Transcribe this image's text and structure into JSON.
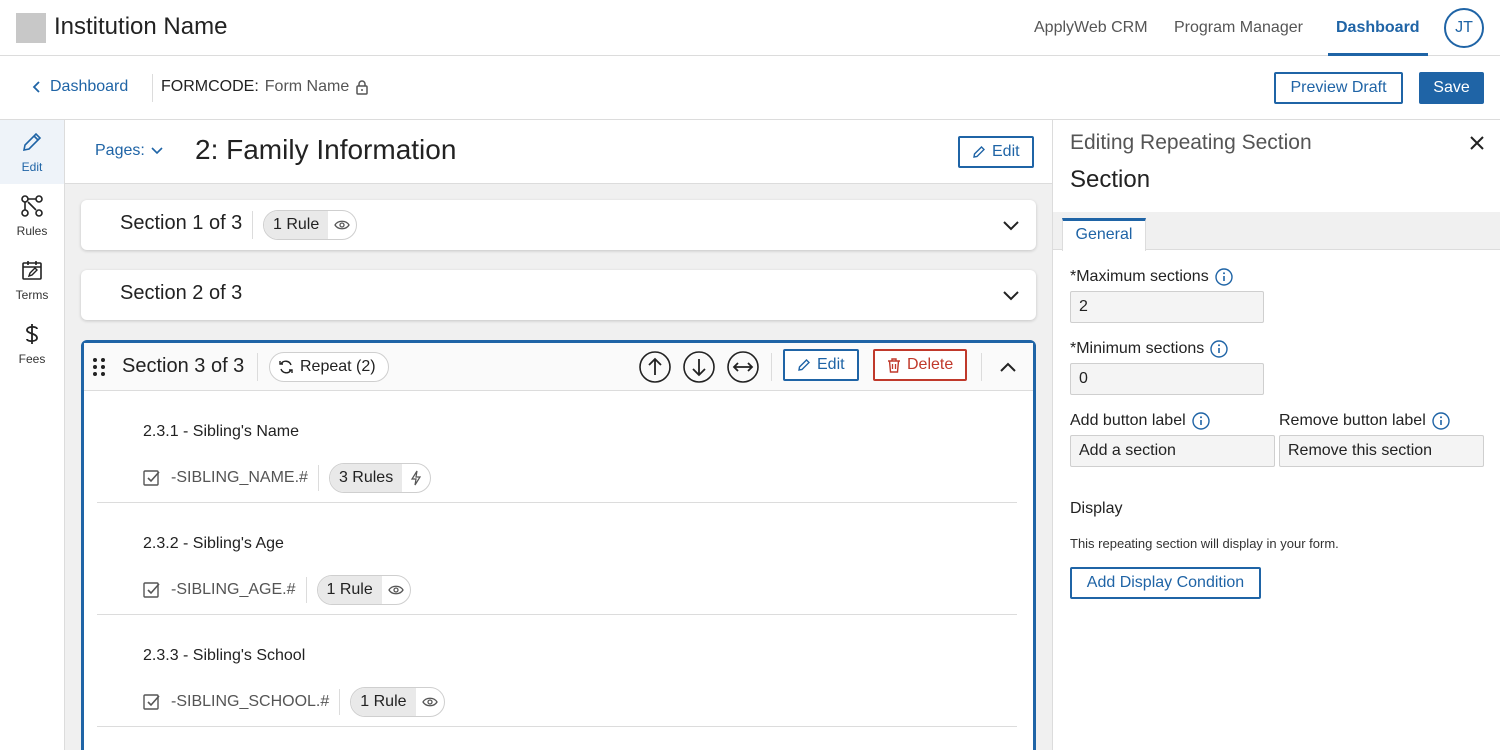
{
  "header": {
    "institution_name": "Institution Name",
    "nav": [
      "ApplyWeb CRM",
      "Program Manager",
      "Dashboard"
    ],
    "active_nav": "Dashboard",
    "avatar_initials": "JT"
  },
  "subheader": {
    "back_label": "Dashboard",
    "formcode_label": "FORMCODE:",
    "form_name": "Form Name",
    "preview_label": "Preview Draft",
    "save_label": "Save"
  },
  "rail": [
    {
      "label": "Edit",
      "icon": "pencil-icon"
    },
    {
      "label": "Rules",
      "icon": "rules-icon"
    },
    {
      "label": "Terms",
      "icon": "calendar-edit-icon"
    },
    {
      "label": "Fees",
      "icon": "dollar-icon"
    }
  ],
  "main": {
    "pages_label": "Pages:",
    "page_title": "2: Family Information",
    "edit_label": "Edit",
    "sections": [
      {
        "title": "Section 1 of 3",
        "chip": "1 Rule"
      },
      {
        "title": "Section 2 of 3"
      }
    ],
    "open_section": {
      "title": "Section 3 of 3",
      "repeat_label": "Repeat (2)",
      "edit_label": "Edit",
      "delete_label": "Delete",
      "fields": [
        {
          "title": "2.3.1 - Sibling's Name",
          "code": "-SIBLING_NAME.#",
          "chip": "3 Rules",
          "chip_icon": "lightning-icon"
        },
        {
          "title": "2.3.2 - Sibling's Age",
          "code": "-SIBLING_AGE.#",
          "chip": "1 Rule",
          "chip_icon": "eye-icon"
        },
        {
          "title": "2.3.3 - Sibling's School",
          "code": "-SIBLING_SCHOOL.#",
          "chip": "1 Rule",
          "chip_icon": "eye-icon"
        }
      ]
    }
  },
  "panel": {
    "subtitle": "Editing Repeating Section",
    "title": "Section",
    "tab": "General",
    "max_label": "*Maximum sections",
    "max_value": "2",
    "min_label": "*Minimum sections",
    "min_value": "0",
    "add_label": "Add button label",
    "add_value": "Add a section",
    "remove_label": "Remove button label",
    "remove_value": "Remove this section",
    "display_heading": "Display",
    "display_text": "This repeating section will display in your form.",
    "display_button": "Add Display Condition"
  },
  "colors": {
    "accent": "#1f64a6",
    "danger": "#c0392b"
  }
}
